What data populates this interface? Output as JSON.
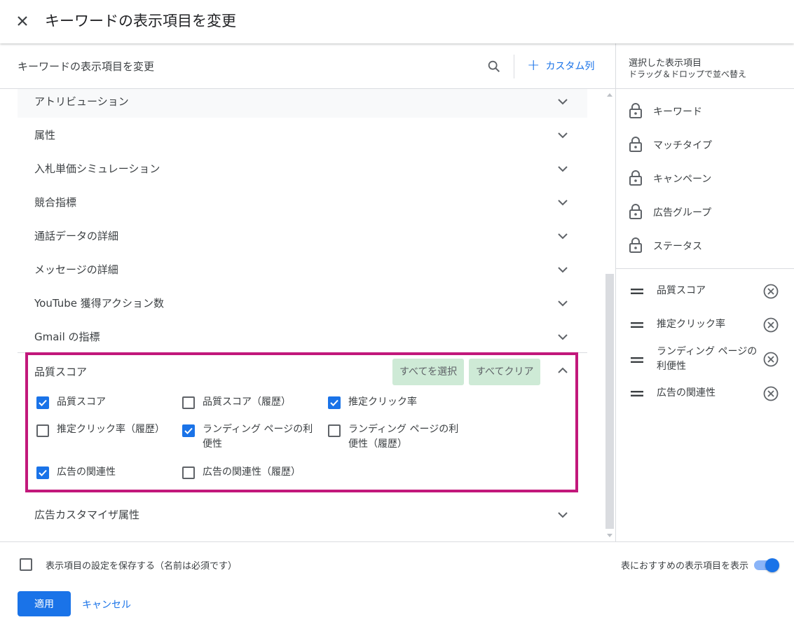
{
  "dialog": {
    "title": "キーワードの表示項目を変更"
  },
  "left": {
    "header_title": "キーワードの表示項目を変更",
    "custom_column": "カスタム列",
    "categories": [
      "アトリビューション",
      "属性",
      "入札単価シミュレーション",
      "競合指標",
      "通話データの詳細",
      "メッセージの詳細",
      "YouTube 獲得アクション数",
      "Gmail の指標"
    ],
    "expanded": {
      "title": "品質スコア",
      "select_all": "すべてを選択",
      "clear_all": "すべてクリア",
      "options": [
        {
          "label": "品質スコア",
          "checked": true
        },
        {
          "label": "品質スコア（履歴）",
          "checked": false
        },
        {
          "label": "推定クリック率",
          "checked": true
        },
        {
          "label": "推定クリック率（履歴）",
          "checked": false
        },
        {
          "label_line1": "ランディング ページの利",
          "label_line2": "便性",
          "checked": true
        },
        {
          "label_line1": "ランディング ページの利",
          "label_line2": "便性（履歴）",
          "checked": false
        },
        {
          "label": "広告の関連性",
          "checked": true
        },
        {
          "label": "広告の関連性（履歴）",
          "checked": false
        }
      ]
    },
    "after_category": "広告カスタマイザ属性"
  },
  "right": {
    "header_line1": "選択した表示項目",
    "header_line2": "ドラッグ＆ドロップで並べ替え",
    "locked": [
      "キーワード",
      "マッチタイプ",
      "キャンペーン",
      "広告グループ",
      "ステータス"
    ],
    "selected": [
      {
        "label": "品質スコア"
      },
      {
        "label": "推定クリック率"
      },
      {
        "label_line1": "ランディング ページの",
        "label_line2": "利便性"
      },
      {
        "label": "広告の関連性"
      }
    ]
  },
  "footer": {
    "save_label": "表示項目の設定を保存する（名前は必須です）",
    "save_checked": false,
    "toggle_label": "表におすすめの表示項目を表示",
    "toggle_on": true,
    "apply": "適用",
    "cancel": "キャンセル"
  },
  "colors": {
    "accent": "#1a73e8",
    "highlight": "#c2187b",
    "chip_bg": "#ceead6"
  }
}
